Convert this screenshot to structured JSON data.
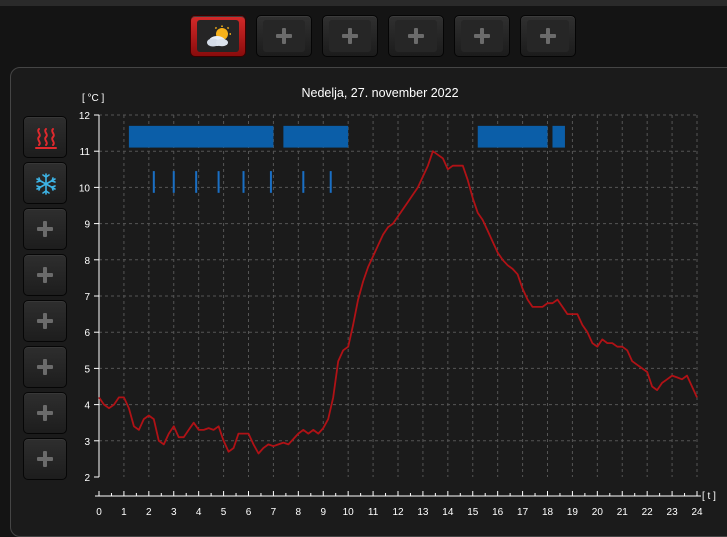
{
  "top_tabs": [
    {
      "icon": "weather-icon",
      "active": true
    },
    {
      "icon": "plus-icon",
      "active": false
    },
    {
      "icon": "plus-icon",
      "active": false
    },
    {
      "icon": "plus-icon",
      "active": false
    },
    {
      "icon": "plus-icon",
      "active": false
    },
    {
      "icon": "plus-icon",
      "active": false
    }
  ],
  "side_buttons": [
    {
      "icon": "heating-icon"
    },
    {
      "icon": "cooling-icon"
    },
    {
      "icon": "plus-icon"
    },
    {
      "icon": "plus-icon"
    },
    {
      "icon": "plus-icon"
    },
    {
      "icon": "plus-icon"
    },
    {
      "icon": "plus-icon"
    },
    {
      "icon": "plus-icon"
    }
  ],
  "colors": {
    "accent": "#c0161c",
    "line": "#b01216",
    "heating_bar": "#0b5ea8",
    "cooling_tick": "#1a6fc4",
    "grid": "#555555"
  },
  "chart_data": {
    "type": "line",
    "title": "Nedelja, 27. november 2022",
    "ylabel": "[ °C ]",
    "xlabel": "[ t ]",
    "xlim": [
      0,
      24
    ],
    "ylim": [
      2,
      12
    ],
    "xticks": [
      0,
      1,
      2,
      3,
      4,
      5,
      6,
      7,
      8,
      9,
      10,
      11,
      12,
      13,
      14,
      15,
      16,
      17,
      18,
      19,
      20,
      21,
      22,
      23,
      24
    ],
    "yticks": [
      2,
      3,
      4,
      5,
      6,
      7,
      8,
      9,
      10,
      11,
      12
    ],
    "grid": true,
    "series": [
      {
        "values": [
          [
            0,
            4.2
          ],
          [
            0.2,
            4.0
          ],
          [
            0.4,
            3.9
          ],
          [
            0.6,
            4.0
          ],
          [
            0.8,
            4.2
          ],
          [
            1.0,
            4.2
          ],
          [
            1.2,
            3.9
          ],
          [
            1.4,
            3.4
          ],
          [
            1.6,
            3.3
          ],
          [
            1.8,
            3.6
          ],
          [
            2.0,
            3.7
          ],
          [
            2.2,
            3.6
          ],
          [
            2.4,
            3.0
          ],
          [
            2.6,
            2.9
          ],
          [
            2.8,
            3.2
          ],
          [
            3.0,
            3.4
          ],
          [
            3.2,
            3.1
          ],
          [
            3.4,
            3.1
          ],
          [
            3.6,
            3.3
          ],
          [
            3.8,
            3.5
          ],
          [
            4.0,
            3.3
          ],
          [
            4.2,
            3.3
          ],
          [
            4.4,
            3.35
          ],
          [
            4.6,
            3.3
          ],
          [
            4.8,
            3.4
          ],
          [
            5.0,
            3.0
          ],
          [
            5.2,
            2.7
          ],
          [
            5.4,
            2.8
          ],
          [
            5.6,
            3.2
          ],
          [
            5.8,
            3.2
          ],
          [
            6.0,
            3.2
          ],
          [
            6.2,
            2.9
          ],
          [
            6.4,
            2.65
          ],
          [
            6.6,
            2.8
          ],
          [
            6.8,
            2.9
          ],
          [
            7.0,
            2.85
          ],
          [
            7.2,
            2.9
          ],
          [
            7.4,
            2.95
          ],
          [
            7.6,
            2.9
          ],
          [
            7.8,
            3.05
          ],
          [
            8.0,
            3.2
          ],
          [
            8.2,
            3.3
          ],
          [
            8.4,
            3.2
          ],
          [
            8.6,
            3.3
          ],
          [
            8.8,
            3.2
          ],
          [
            9.0,
            3.35
          ],
          [
            9.2,
            3.6
          ],
          [
            9.4,
            4.2
          ],
          [
            9.6,
            5.2
          ],
          [
            9.8,
            5.5
          ],
          [
            10.0,
            5.6
          ],
          [
            10.2,
            6.2
          ],
          [
            10.4,
            6.9
          ],
          [
            10.6,
            7.4
          ],
          [
            10.8,
            7.8
          ],
          [
            11.0,
            8.1
          ],
          [
            11.2,
            8.4
          ],
          [
            11.4,
            8.7
          ],
          [
            11.6,
            8.9
          ],
          [
            11.8,
            9.0
          ],
          [
            12.0,
            9.2
          ],
          [
            12.2,
            9.4
          ],
          [
            12.4,
            9.6
          ],
          [
            12.6,
            9.8
          ],
          [
            12.8,
            10.0
          ],
          [
            13.0,
            10.3
          ],
          [
            13.2,
            10.6
          ],
          [
            13.4,
            11.0
          ],
          [
            13.6,
            10.9
          ],
          [
            13.8,
            10.8
          ],
          [
            14.0,
            10.5
          ],
          [
            14.2,
            10.6
          ],
          [
            14.4,
            10.6
          ],
          [
            14.6,
            10.6
          ],
          [
            14.8,
            10.2
          ],
          [
            15.0,
            9.7
          ],
          [
            15.2,
            9.3
          ],
          [
            15.4,
            9.1
          ],
          [
            15.6,
            8.8
          ],
          [
            15.8,
            8.5
          ],
          [
            16.0,
            8.2
          ],
          [
            16.2,
            8.0
          ],
          [
            16.4,
            7.85
          ],
          [
            16.6,
            7.75
          ],
          [
            16.8,
            7.6
          ],
          [
            17.0,
            7.2
          ],
          [
            17.2,
            6.9
          ],
          [
            17.4,
            6.7
          ],
          [
            17.6,
            6.7
          ],
          [
            17.8,
            6.7
          ],
          [
            18.0,
            6.8
          ],
          [
            18.2,
            6.8
          ],
          [
            18.4,
            6.9
          ],
          [
            18.6,
            6.7
          ],
          [
            18.8,
            6.5
          ],
          [
            19.0,
            6.5
          ],
          [
            19.2,
            6.5
          ],
          [
            19.4,
            6.2
          ],
          [
            19.6,
            6.0
          ],
          [
            19.8,
            5.7
          ],
          [
            20.0,
            5.6
          ],
          [
            20.2,
            5.8
          ],
          [
            20.4,
            5.7
          ],
          [
            20.6,
            5.7
          ],
          [
            20.8,
            5.6
          ],
          [
            21.0,
            5.6
          ],
          [
            21.2,
            5.5
          ],
          [
            21.4,
            5.2
          ],
          [
            21.6,
            5.1
          ],
          [
            21.8,
            5.0
          ],
          [
            22.0,
            4.9
          ],
          [
            22.2,
            4.5
          ],
          [
            22.4,
            4.4
          ],
          [
            22.6,
            4.6
          ],
          [
            22.8,
            4.7
          ],
          [
            23.0,
            4.8
          ],
          [
            23.2,
            4.75
          ],
          [
            23.4,
            4.7
          ],
          [
            23.6,
            4.8
          ],
          [
            23.8,
            4.5
          ],
          [
            24.0,
            4.2
          ]
        ]
      }
    ],
    "heating_bars": [
      [
        1.2,
        7.0
      ],
      [
        7.4,
        10.0
      ],
      [
        15.2,
        18.0
      ],
      [
        18.2,
        18.7
      ]
    ],
    "heating_bar_range": [
      11.1,
      11.7
    ],
    "cooling_ticks": [
      2.2,
      3.0,
      3.9,
      4.8,
      5.8,
      6.9,
      8.2,
      9.3
    ],
    "cooling_tick_range": [
      9.85,
      10.45
    ]
  }
}
